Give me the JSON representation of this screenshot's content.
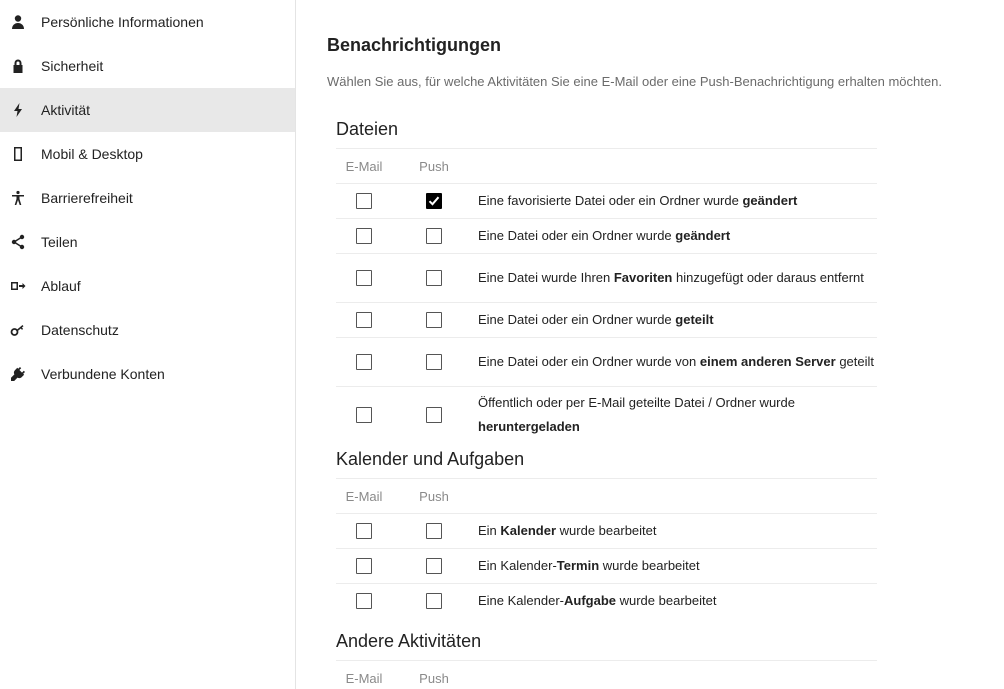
{
  "sidebar": {
    "items": [
      {
        "label": "Persönliche Informationen",
        "icon": "person-icon"
      },
      {
        "label": "Sicherheit",
        "icon": "lock-icon"
      },
      {
        "label": "Aktivität",
        "icon": "lightning-icon",
        "active": true
      },
      {
        "label": "Mobil & Desktop",
        "icon": "phone-icon"
      },
      {
        "label": "Barrierefreiheit",
        "icon": "accessibility-icon"
      },
      {
        "label": "Teilen",
        "icon": "share-icon"
      },
      {
        "label": "Ablauf",
        "icon": "flow-icon"
      },
      {
        "label": "Datenschutz",
        "icon": "key-icon"
      },
      {
        "label": "Verbundene Konten",
        "icon": "plug-icon"
      }
    ]
  },
  "main": {
    "title": "Benachrichtigungen",
    "description": "Wählen Sie aus, für welche Aktivitäten Sie eine E-Mail oder eine Push-Benachrichtigung erhalten möchten.",
    "columns": {
      "email": "E-Mail",
      "push": "Push"
    },
    "sections": [
      {
        "title": "Dateien",
        "rows": [
          {
            "pre": "Eine favorisierte Datei oder ein Ordner wurde ",
            "bold": "geändert",
            "post": "",
            "email": false,
            "push": true
          },
          {
            "pre": "Eine Datei oder ein Ordner wurde ",
            "bold": "geändert",
            "post": "",
            "email": false,
            "push": false
          },
          {
            "pre": "Eine Datei wurde Ihren ",
            "bold": "Favoriten",
            "post": " hinzugefügt oder daraus entfernt",
            "email": false,
            "push": false
          },
          {
            "pre": "Eine Datei oder ein Ordner wurde ",
            "bold": "geteilt",
            "post": "",
            "email": false,
            "push": false
          },
          {
            "pre": "Eine Datei oder ein Ordner wurde von ",
            "bold": "einem anderen Server",
            "post": " geteilt",
            "email": false,
            "push": false
          },
          {
            "pre": "Öffentlich oder per E-Mail geteilte Datei / Ordner wurde ",
            "bold": "heruntergeladen",
            "post": "",
            "email": false,
            "push": false
          }
        ]
      },
      {
        "title": "Kalender und Aufgaben",
        "rows": [
          {
            "pre": "Ein ",
            "bold": "Kalender",
            "post": " wurde bearbeitet",
            "email": false,
            "push": false
          },
          {
            "pre": "Ein Kalender-",
            "bold": "Termin",
            "post": " wurde bearbeitet",
            "email": false,
            "push": false
          },
          {
            "pre": "Eine Kalender-",
            "bold": "Aufgabe",
            "post": " wurde bearbeitet",
            "email": false,
            "push": false
          }
        ]
      },
      {
        "title": "Andere Aktivitäten",
        "rows": []
      }
    ]
  }
}
